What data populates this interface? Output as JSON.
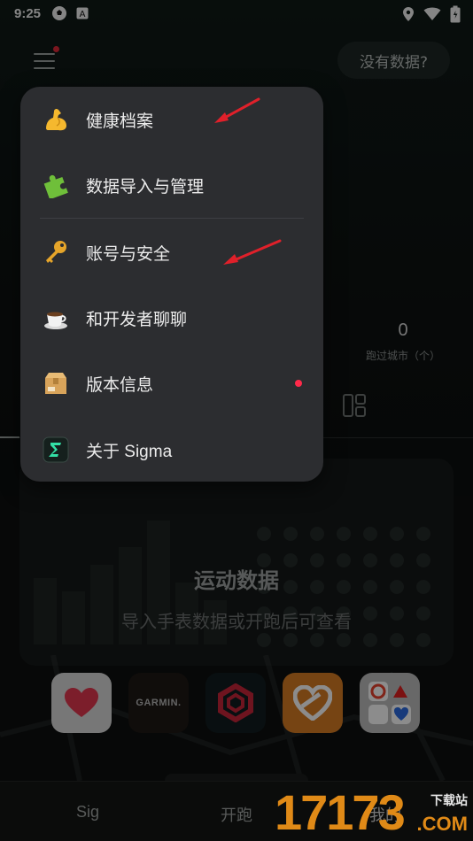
{
  "status_bar": {
    "time": "9:25"
  },
  "header": {
    "no_data_button": "没有数据?"
  },
  "stats": {
    "cities_value": "0",
    "cities_label": "跑过城市（个）"
  },
  "card": {
    "title": "运动数据",
    "subtitle": "导入手表数据或开跑后可查看"
  },
  "apps": {
    "garmin_label": "GARMIN."
  },
  "bottom_nav": {
    "sig": "Sig",
    "run": "开跑",
    "mine": "我的"
  },
  "popup_menu": {
    "items": [
      {
        "label": "健康档案",
        "icon": "flexed-biceps-icon"
      },
      {
        "label": "数据导入与管理",
        "icon": "puzzle-piece-icon"
      },
      {
        "label": "账号与安全",
        "icon": "key-icon"
      },
      {
        "label": "和开发者聊聊",
        "icon": "coffee-cup-icon"
      },
      {
        "label": "版本信息",
        "icon": "package-box-icon"
      },
      {
        "label": "关于 Sigma",
        "icon": "sigma-logo-icon"
      }
    ]
  },
  "colors": {
    "popup_bg": "#2c2d30",
    "notification_dot": "#ff2a4a",
    "annotation_arrow": "#e0202a",
    "watermark_orange": "#e08a17"
  },
  "watermark": {
    "number": "17173",
    "site_text": "下载站",
    "domain": ".COM"
  }
}
